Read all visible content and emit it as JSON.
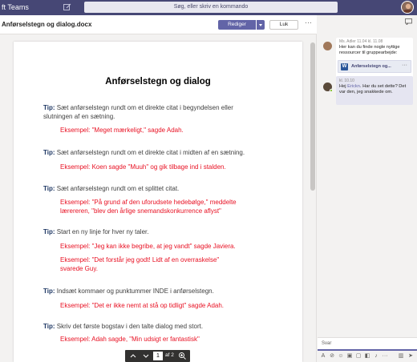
{
  "app": {
    "title": "ft Teams"
  },
  "search": {
    "placeholder": "Søg, eller skriv en kommando"
  },
  "document": {
    "filename": "Anførselstegn og dialog.docx",
    "edit_label": "Rediger",
    "close_label": "Luk",
    "title": "Anførselstegn og dialog",
    "tips": [
      {
        "tip_label": "Tip:",
        "tip": "Sæt anførselstegn rundt om et direkte citat i begyndelsen eller",
        "tip2": "slutningen af en sætning.",
        "ex_label": "Eksempel:",
        "ex": "\"Meget mærkeligt,\" sagde Adah.",
        "ex2": ""
      },
      {
        "tip_label": "Tip:",
        "tip": "Sæt anførselstegn rundt om et direkte citat i midten af en sætning.",
        "tip2": "",
        "ex_label": "Eksempel:",
        "ex": "Koen sagde \"Muuh\" og gik tilbage ind i stalden.",
        "ex2": ""
      },
      {
        "tip_label": "Tip:",
        "tip": "Sæt anførselstegn rundt om et splittet citat.",
        "tip2": "",
        "ex_label": "Eksempel:",
        "ex": "\"På grund af den uforudsete hedebølge,\" meddelte",
        "ex2": "lærereren, \"blev den årlige snemandskonkurrence aflyst\""
      },
      {
        "tip_label": "Tip:",
        "tip": "Start en ny linje for hver ny taler.",
        "tip2": "",
        "ex_label": "Eksempel:",
        "ex": "\"Jeg kan ikke begribe, at jeg vandt\" sagde Javiera.",
        "ex2": "",
        "ex_b_label": "Eksempel:",
        "ex_b": "\"Det forstår jeg godt! Lidt af en overraskelse\"",
        "ex_b2": "svarede Guy."
      },
      {
        "tip_label": "Tip:",
        "tip": "Indsæt kommaer og punktummer INDE i anførselstegn.",
        "tip2": "",
        "ex_label": "Eksempel:",
        "ex": "\"Det er ikke nemt at stå op tidligt\" sagde Adah.",
        "ex2": ""
      },
      {
        "tip_label": "Tip:",
        "tip": "Skriv det første bogstav i den talte dialog med stort.",
        "tip2": "",
        "ex_label": "Eksempel:",
        "ex": "Adah sagde, \"Min udsigt er fantastisk\"",
        "ex2": ""
      }
    ],
    "pager": {
      "current": "1",
      "of": "af 2"
    }
  },
  "chat": {
    "msg1": {
      "meta": "Ms. Adler   11.04 kl. 11.08",
      "text": "Her kan du finde nogle nyttige ressourcer til gruppearbejde:",
      "attachment": "Anførselstegn og..."
    },
    "msg2": {
      "meta": "kl. 10.10",
      "greet": "Hej ",
      "mention": "Erickn",
      "text_rest": ". Har du set dette? Det var den, jeg snakkede om."
    },
    "reply_placeholder": "Svar"
  },
  "colors": {
    "topbar": "#464775",
    "accent": "#6264a7",
    "example_red": "#e81123",
    "tip_label": "#1f3864"
  }
}
